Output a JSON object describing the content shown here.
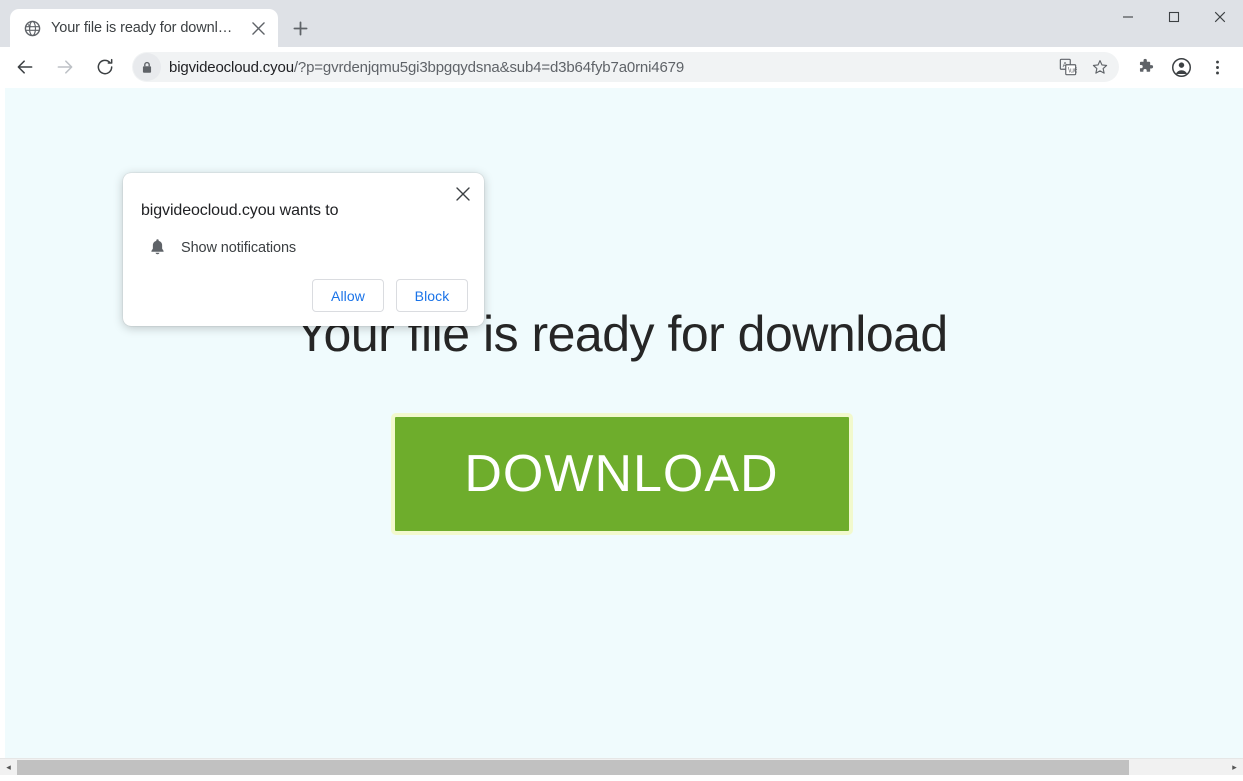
{
  "window": {
    "controls": {
      "minimize": "minimize-button",
      "maximize": "maximize-button",
      "close": "close-button"
    }
  },
  "tab_strip": {
    "tabs": [
      {
        "title": "Your file is ready for download",
        "favicon": "globe-icon",
        "active": true
      }
    ],
    "new_tab_label": "+"
  },
  "toolbar": {
    "back_label": "Back",
    "forward_label": "Forward",
    "reload_label": "Reload",
    "omnibox": {
      "lock_icon": "lock-icon",
      "url_host": "bigvideocloud.cyou",
      "url_path": "/?p=gvrdenjqmu5gi3bpgqydsna&sub4=d3b64fyb7a0rni4679",
      "full_url": "bigvideocloud.cyou/?p=gvrdenjqmu5gi3bpgqydsna&sub4=d3b64fyb7a0rni4679",
      "translate_icon": "translate-icon",
      "bookmark_icon": "star-icon"
    },
    "extensions_icon": "puzzle-icon",
    "profile_icon": "account-avatar-icon",
    "menu_icon": "three-dot-menu-icon"
  },
  "permission_dialog": {
    "title": "bigvideocloud.cyou wants to",
    "request_icon": "bell-icon",
    "request_label": "Show notifications",
    "allow_label": "Allow",
    "block_label": "Block",
    "close_label": "×"
  },
  "page": {
    "heading": "Your file is ready for download",
    "download_label": "DOWNLOAD",
    "background_color": "#f0fbfd",
    "download_button_color": "#6EAD2C",
    "download_button_border_color": "#f2f9cd",
    "download_text_color": "#ffffff",
    "cut_off_text": " "
  },
  "scrollbar": {
    "left_arrow": "◂",
    "right_arrow": "▸",
    "orientation": "horizontal"
  }
}
